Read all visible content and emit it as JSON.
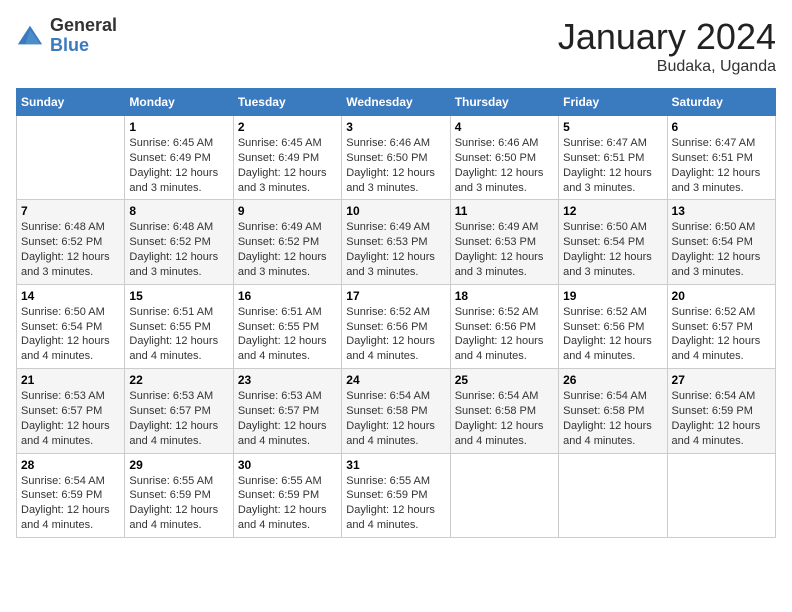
{
  "logo": {
    "general": "General",
    "blue": "Blue"
  },
  "title": "January 2024",
  "location": "Budaka, Uganda",
  "days_header": [
    "Sunday",
    "Monday",
    "Tuesday",
    "Wednesday",
    "Thursday",
    "Friday",
    "Saturday"
  ],
  "weeks": [
    [
      {
        "day": "",
        "empty": true
      },
      {
        "day": "1",
        "sunrise": "6:45 AM",
        "sunset": "6:49 PM",
        "daylight": "12 hours and 3 minutes."
      },
      {
        "day": "2",
        "sunrise": "6:45 AM",
        "sunset": "6:49 PM",
        "daylight": "12 hours and 3 minutes."
      },
      {
        "day": "3",
        "sunrise": "6:46 AM",
        "sunset": "6:50 PM",
        "daylight": "12 hours and 3 minutes."
      },
      {
        "day": "4",
        "sunrise": "6:46 AM",
        "sunset": "6:50 PM",
        "daylight": "12 hours and 3 minutes."
      },
      {
        "day": "5",
        "sunrise": "6:47 AM",
        "sunset": "6:51 PM",
        "daylight": "12 hours and 3 minutes."
      },
      {
        "day": "6",
        "sunrise": "6:47 AM",
        "sunset": "6:51 PM",
        "daylight": "12 hours and 3 minutes."
      }
    ],
    [
      {
        "day": "7",
        "sunrise": "6:48 AM",
        "sunset": "6:52 PM",
        "daylight": "12 hours and 3 minutes."
      },
      {
        "day": "8",
        "sunrise": "6:48 AM",
        "sunset": "6:52 PM",
        "daylight": "12 hours and 3 minutes."
      },
      {
        "day": "9",
        "sunrise": "6:49 AM",
        "sunset": "6:52 PM",
        "daylight": "12 hours and 3 minutes."
      },
      {
        "day": "10",
        "sunrise": "6:49 AM",
        "sunset": "6:53 PM",
        "daylight": "12 hours and 3 minutes."
      },
      {
        "day": "11",
        "sunrise": "6:49 AM",
        "sunset": "6:53 PM",
        "daylight": "12 hours and 3 minutes."
      },
      {
        "day": "12",
        "sunrise": "6:50 AM",
        "sunset": "6:54 PM",
        "daylight": "12 hours and 3 minutes."
      },
      {
        "day": "13",
        "sunrise": "6:50 AM",
        "sunset": "6:54 PM",
        "daylight": "12 hours and 3 minutes."
      }
    ],
    [
      {
        "day": "14",
        "sunrise": "6:50 AM",
        "sunset": "6:54 PM",
        "daylight": "12 hours and 4 minutes."
      },
      {
        "day": "15",
        "sunrise": "6:51 AM",
        "sunset": "6:55 PM",
        "daylight": "12 hours and 4 minutes."
      },
      {
        "day": "16",
        "sunrise": "6:51 AM",
        "sunset": "6:55 PM",
        "daylight": "12 hours and 4 minutes."
      },
      {
        "day": "17",
        "sunrise": "6:52 AM",
        "sunset": "6:56 PM",
        "daylight": "12 hours and 4 minutes."
      },
      {
        "day": "18",
        "sunrise": "6:52 AM",
        "sunset": "6:56 PM",
        "daylight": "12 hours and 4 minutes."
      },
      {
        "day": "19",
        "sunrise": "6:52 AM",
        "sunset": "6:56 PM",
        "daylight": "12 hours and 4 minutes."
      },
      {
        "day": "20",
        "sunrise": "6:52 AM",
        "sunset": "6:57 PM",
        "daylight": "12 hours and 4 minutes."
      }
    ],
    [
      {
        "day": "21",
        "sunrise": "6:53 AM",
        "sunset": "6:57 PM",
        "daylight": "12 hours and 4 minutes."
      },
      {
        "day": "22",
        "sunrise": "6:53 AM",
        "sunset": "6:57 PM",
        "daylight": "12 hours and 4 minutes."
      },
      {
        "day": "23",
        "sunrise": "6:53 AM",
        "sunset": "6:57 PM",
        "daylight": "12 hours and 4 minutes."
      },
      {
        "day": "24",
        "sunrise": "6:54 AM",
        "sunset": "6:58 PM",
        "daylight": "12 hours and 4 minutes."
      },
      {
        "day": "25",
        "sunrise": "6:54 AM",
        "sunset": "6:58 PM",
        "daylight": "12 hours and 4 minutes."
      },
      {
        "day": "26",
        "sunrise": "6:54 AM",
        "sunset": "6:58 PM",
        "daylight": "12 hours and 4 minutes."
      },
      {
        "day": "27",
        "sunrise": "6:54 AM",
        "sunset": "6:59 PM",
        "daylight": "12 hours and 4 minutes."
      }
    ],
    [
      {
        "day": "28",
        "sunrise": "6:54 AM",
        "sunset": "6:59 PM",
        "daylight": "12 hours and 4 minutes."
      },
      {
        "day": "29",
        "sunrise": "6:55 AM",
        "sunset": "6:59 PM",
        "daylight": "12 hours and 4 minutes."
      },
      {
        "day": "30",
        "sunrise": "6:55 AM",
        "sunset": "6:59 PM",
        "daylight": "12 hours and 4 minutes."
      },
      {
        "day": "31",
        "sunrise": "6:55 AM",
        "sunset": "6:59 PM",
        "daylight": "12 hours and 4 minutes."
      },
      {
        "day": "",
        "empty": true
      },
      {
        "day": "",
        "empty": true
      },
      {
        "day": "",
        "empty": true
      }
    ]
  ],
  "labels": {
    "sunrise": "Sunrise:",
    "sunset": "Sunset:",
    "daylight": "Daylight:"
  }
}
